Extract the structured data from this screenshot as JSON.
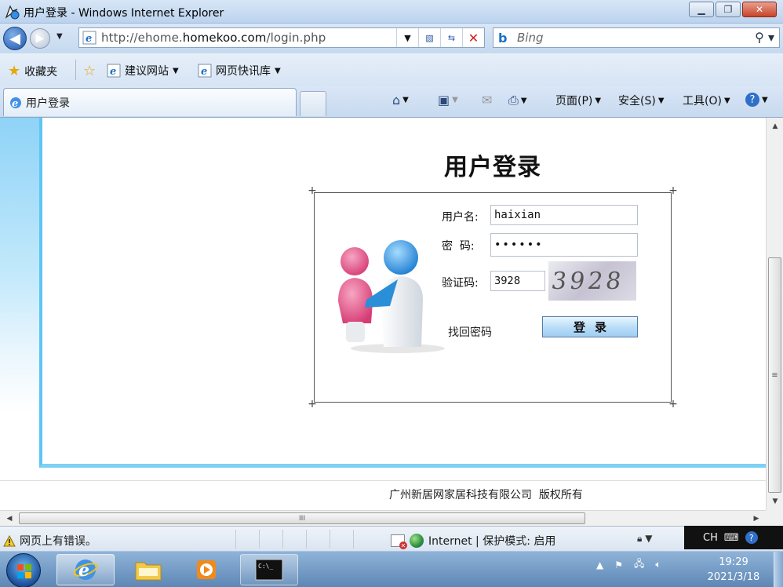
{
  "window": {
    "title": "用户登录 - Windows Internet Explorer"
  },
  "address": {
    "url_prefix": "http://ehome.",
    "url_domain": "homekoo.com",
    "url_suffix": "/login.php"
  },
  "search": {
    "placeholder": "Bing"
  },
  "favorites": {
    "label": "收藏夹",
    "items": [
      {
        "label": "建议网站"
      },
      {
        "label": "网页快讯库"
      }
    ]
  },
  "tab": {
    "label": "用户登录"
  },
  "commands": {
    "page": "页面(P)",
    "safety": "安全(S)",
    "tools": "工具(O)"
  },
  "login": {
    "title": "用户登录",
    "username_label": "用户名:",
    "username_value": "haixian",
    "password_label": "密  码:",
    "password_value": "••••••",
    "captcha_label": "验证码:",
    "captcha_value": "3928",
    "captcha_image_text": "3928",
    "forgot_link": "找回密码",
    "submit_label": "登录"
  },
  "footer": {
    "copyright": "广州新居网家居科技有限公司  版权所有"
  },
  "scrollbar": {
    "h_thumb_grip": "III",
    "v_thumb_grip": "≡"
  },
  "status": {
    "message": "网页上有错误。",
    "zone": "Internet | 保护模式: 启用"
  },
  "language": {
    "code": "CH"
  },
  "clock": {
    "time": "19:29",
    "date": "2021/3/18"
  },
  "colors": {
    "frame_accent": "#5fc6f3",
    "ie_blue": "#1a70c6",
    "close_red": "#c8432a"
  }
}
